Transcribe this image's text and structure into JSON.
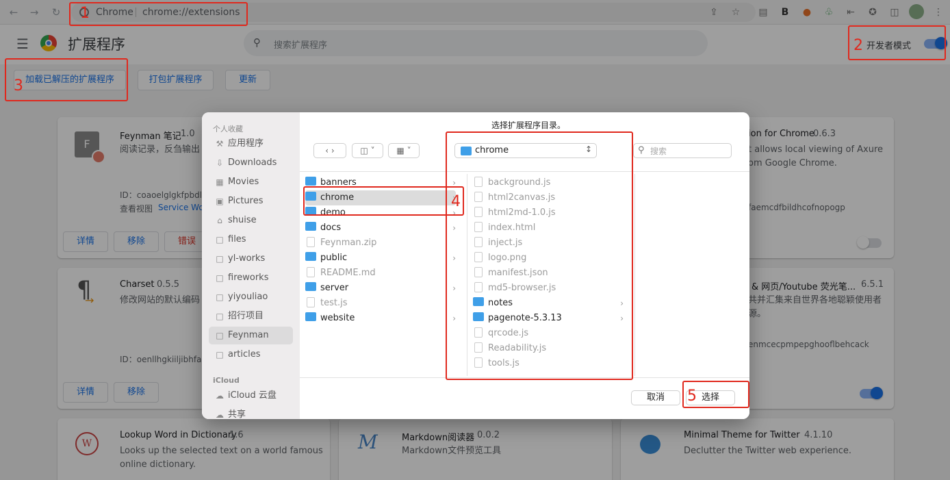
{
  "browser": {
    "tab_label": "Chrome",
    "url": "chrome://extensions"
  },
  "header": {
    "title": "扩展程序",
    "search_placeholder": "搜索扩展程序",
    "dev_mode_label": "开发者模式",
    "dev_mode_on": true
  },
  "toolbar": {
    "load_unpacked": "加载已解压的扩展程序",
    "pack": "打包扩展程序",
    "update": "更新"
  },
  "cards": [
    {
      "name": "Feynman 笔记",
      "version": "1.0",
      "desc": "阅读记录，反刍输出",
      "id": "ID：coaoelglgkfpbdl",
      "view": "查看视图",
      "view_link": "Service Wo",
      "btn_details": "详情",
      "btn_remove": "移除",
      "btn_error": "错误"
    },
    {
      "name": "ion for Chrome",
      "version": "0.6.3",
      "desc": "t allows local viewing of Axure",
      "desc2": "om Google Chrome.",
      "id": "faemcdfbildhcofnopogp",
      "enabled": false
    },
    {
      "name": "Charset",
      "version": "0.5.5",
      "desc": "修改网站的默认编码",
      "id": "ID：oenllhgkiiljibhfag",
      "btn_details": "详情",
      "btn_remove": "移除"
    },
    {
      "name": "& 网页/Youtube 荧光笔...",
      "version": "6.5.1",
      "desc": "共并汇集来自世界各地聪颖使用者",
      "desc2": "源。",
      "id": "enmcecpmpepghooflbehcack",
      "enabled": true
    },
    {
      "name": "Lookup Word in Dictionary",
      "version": "1.6",
      "desc": "Looks up the selected text on a world famous",
      "desc2": "online dictionary."
    },
    {
      "name": "Markdown阅读器",
      "version": "0.0.2",
      "desc": "Markdown文件预览工具"
    },
    {
      "name": "Minimal Theme for Twitter",
      "version": "4.1.10",
      "desc": "Declutter the Twitter web experience."
    }
  ],
  "dialog": {
    "title": "选择扩展程序目录。",
    "path": "chrome",
    "search_placeholder": "搜索",
    "sidebar_favorites_heading": "个人收藏",
    "sidebar_icloud_heading": "iCloud",
    "favorites": [
      "应用程序",
      "Downloads",
      "Movies",
      "Pictures",
      "shuise",
      "files",
      "yl-works",
      "fireworks",
      "yiyouliao",
      "招行项目",
      "Feynman",
      "articles"
    ],
    "favorites_selected": "Feynman",
    "icloud": [
      "iCloud 云盘",
      "共享"
    ],
    "col1": [
      {
        "name": "banners",
        "kind": "folder"
      },
      {
        "name": "chrome",
        "kind": "folder",
        "selected": true
      },
      {
        "name": "demo",
        "kind": "folder"
      },
      {
        "name": "docs",
        "kind": "folder"
      },
      {
        "name": "Feynman.zip",
        "kind": "file"
      },
      {
        "name": "public",
        "kind": "folder"
      },
      {
        "name": "README.md",
        "kind": "file"
      },
      {
        "name": "server",
        "kind": "folder"
      },
      {
        "name": "test.js",
        "kind": "file"
      },
      {
        "name": "website",
        "kind": "folder"
      }
    ],
    "col2": [
      {
        "name": "background.js",
        "kind": "file"
      },
      {
        "name": "html2canvas.js",
        "kind": "file"
      },
      {
        "name": "html2md-1.0.js",
        "kind": "file"
      },
      {
        "name": "index.html",
        "kind": "file"
      },
      {
        "name": "inject.js",
        "kind": "file"
      },
      {
        "name": "logo.png",
        "kind": "file"
      },
      {
        "name": "manifest.json",
        "kind": "file"
      },
      {
        "name": "md5-browser.js",
        "kind": "file"
      },
      {
        "name": "notes",
        "kind": "folder"
      },
      {
        "name": "pagenote-5.3.13",
        "kind": "folder"
      },
      {
        "name": "qrcode.js",
        "kind": "file"
      },
      {
        "name": "Readability.js",
        "kind": "file"
      },
      {
        "name": "tools.js",
        "kind": "file"
      }
    ],
    "cancel": "取消",
    "choose": "选择"
  },
  "annotations": [
    "1",
    "2",
    "3",
    "4",
    "5"
  ],
  "colors": {
    "annotation": "#e0281d",
    "accent": "#1a73e8",
    "folder": "#3f9fe8"
  }
}
